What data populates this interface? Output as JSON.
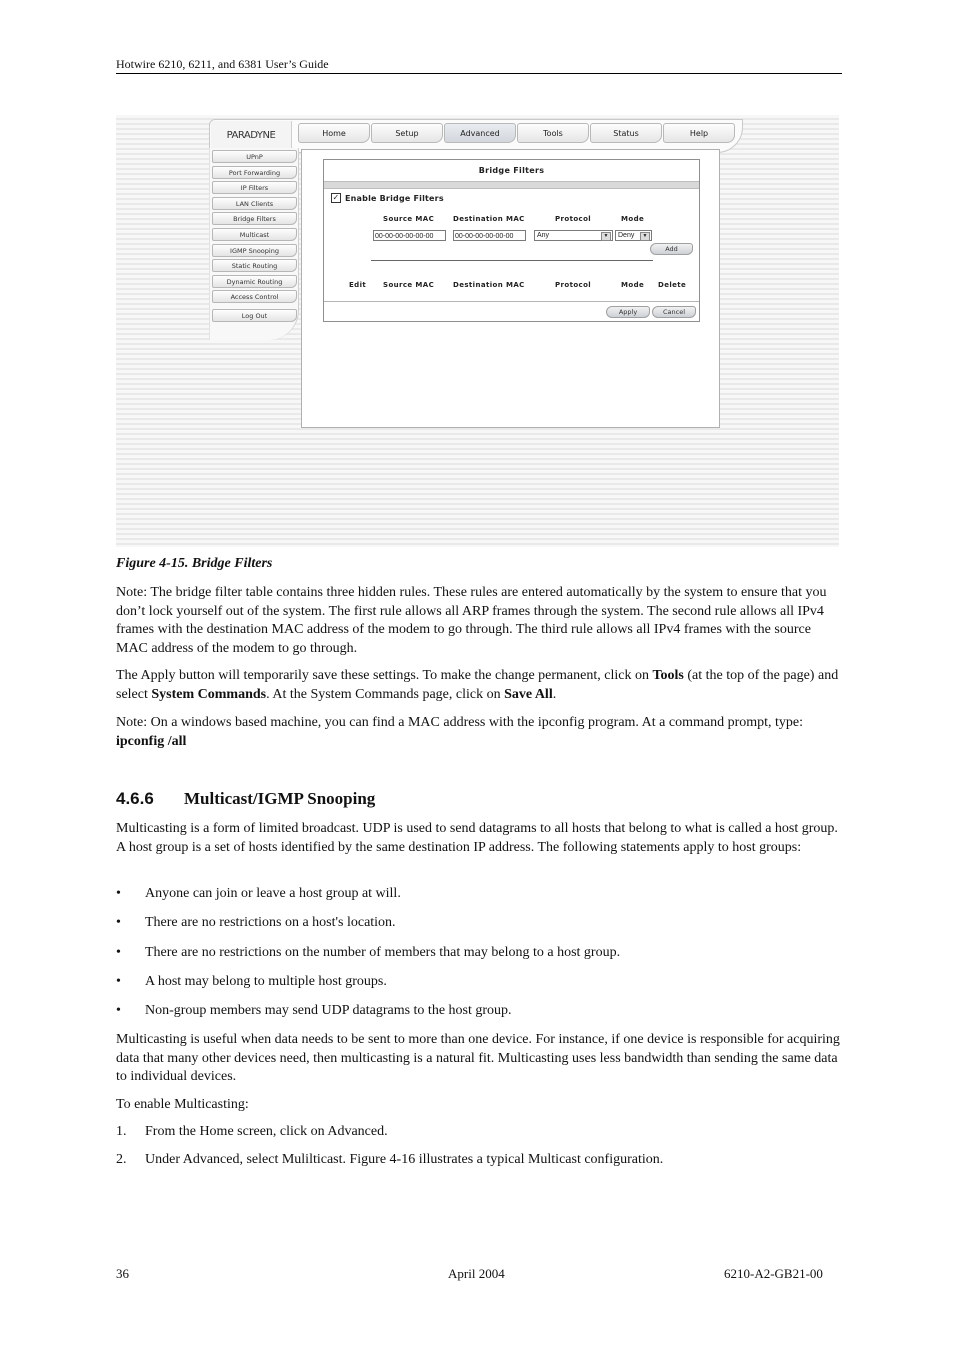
{
  "header": {
    "running_title": "Hotwire 6210, 6211, and 6381 User’s Guide"
  },
  "figure": {
    "logo": "PARADYNE",
    "nav_tabs": [
      {
        "label": "Home",
        "active": false
      },
      {
        "label": "Setup",
        "active": false
      },
      {
        "label": "Advanced",
        "active": true
      },
      {
        "label": "Tools",
        "active": false
      },
      {
        "label": "Status",
        "active": false
      },
      {
        "label": "Help",
        "active": false
      }
    ],
    "sidebar": [
      "UPnP",
      "Port Forwarding",
      "IP Filters",
      "LAN Clients",
      "Bridge Filters",
      "Multicast",
      "IGMP Snooping",
      "Static Routing",
      "Dynamic Routing",
      "Access Control"
    ],
    "logout_label": "Log Out",
    "form": {
      "title": "Bridge Filters",
      "enable_label": "Enable Bridge Filters",
      "enable_checked": true,
      "checkbox_glyph": "✓",
      "input_headers": {
        "source_mac": "Source MAC",
        "destination_mac": "Destination MAC",
        "protocol": "Protocol",
        "mode": "Mode"
      },
      "source_mac_value": "00-00-00-00-00-00",
      "destination_mac_value": "00-00-00-00-00-00",
      "protocol_value": "Any",
      "mode_value": "Deny",
      "dropdown_glyph": "▼",
      "add_label": "Add",
      "table_headers": [
        "Edit",
        "Source MAC",
        "Destination MAC",
        "Protocol",
        "Mode",
        "Delete"
      ],
      "table_rows": [],
      "apply_label": "Apply",
      "cancel_label": "Cancel"
    }
  },
  "caption": "Figure 4-15. Bridge Filters",
  "note1": "Note: The bridge filter table contains three hidden rules. These rules are entered automatically by the system to ensure that you don’t lock yourself out of the system. The first rule allows all ARP frames through the system. The second rule allows all IPv4 frames with the destination MAC address of the modem to go through. The third rule allows all IPv4 frames with the source MAC address of the modem to go through.",
  "apply_para": {
    "t1": "The Apply button will temporarily save these settings. To make the change permanent, click on ",
    "b1": "Tools",
    "t2": " (at the top of the page) and select ",
    "b2": "System Commands",
    "t3": ". At the System Commands page, click on ",
    "b3": "Save All",
    "t4": "."
  },
  "note2": {
    "text": "Note: On a windows based machine, you can find a MAC address with the ipconfig program. At a command prompt, type: ",
    "command": "ipconfig /all"
  },
  "section": {
    "number": "4.6.6",
    "title": "Multicast/IGMP Snooping",
    "intro": "Multicasting is a form of limited broadcast. UDP is used to send datagrams to all hosts that belong to what is called a host group. A host group is a set of hosts identified by the same destination IP address. The following statements apply to host groups:",
    "bullets": [
      "Anyone can join or leave a host group at will.",
      "There are no restrictions on a host's location.",
      "There are no restrictions on the number of members that may belong to a host group.",
      "A host may belong to multiple host groups.",
      "Non-group members may send UDP datagrams to the host group."
    ],
    "bullet_glyph": "•",
    "usefulness": "Multicasting is useful when data needs to be sent to more than one device. For instance, if one device is responsible for acquiring data that many other devices need, then multicasting is a natural fit. Multicasting uses less bandwidth than sending the same data to individual devices.",
    "steps_intro": "To enable Multicasting:",
    "steps": [
      {
        "num": "1.",
        "text": "From the Home screen, click on Advanced."
      },
      {
        "num": "2.",
        "text": "Under Advanced, select Mulilticast.  Figure 4-16 illustrates a typical Multicast configuration."
      }
    ]
  },
  "footer": {
    "page_number": "36",
    "date": "April 2004",
    "doc_id": "6210-A2-GB21-00"
  }
}
